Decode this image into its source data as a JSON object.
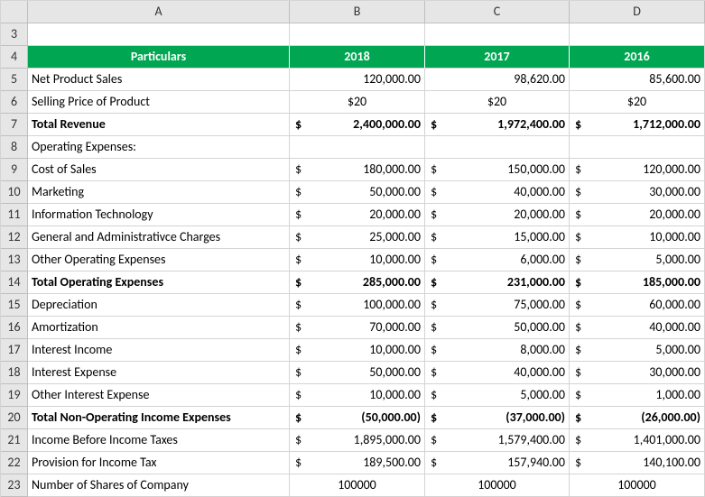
{
  "columns": [
    "A",
    "B",
    "C",
    "D"
  ],
  "row_numbers": [
    "3",
    "4",
    "5",
    "6",
    "7",
    "8",
    "9",
    "10",
    "11",
    "12",
    "13",
    "14",
    "15",
    "16",
    "17",
    "18",
    "19",
    "20",
    "21",
    "22",
    "23"
  ],
  "header": {
    "particulars": "Particulars",
    "y2018": "2018",
    "y2017": "2017",
    "y2016": "2016"
  },
  "rows": {
    "r5": {
      "label": "Net Product Sales",
      "b": "120,000.00",
      "c": "98,620.00",
      "d": "85,600.00",
      "money": false,
      "bold": false,
      "center": false
    },
    "r6": {
      "label": "Selling Price of Product",
      "b": "$20",
      "c": "$20",
      "d": "$20",
      "money": false,
      "bold": false,
      "center": true
    },
    "r7": {
      "label": "Total Revenue",
      "b": "2,400,000.00",
      "c": "1,972,400.00",
      "d": "1,712,000.00",
      "money": true,
      "bold": true,
      "center": false
    },
    "r8": {
      "label": "Operating Expenses:",
      "b": "",
      "c": "",
      "d": "",
      "money": false,
      "bold": false,
      "center": false
    },
    "r9": {
      "label": "Cost of Sales",
      "b": "180,000.00",
      "c": "150,000.00",
      "d": "120,000.00",
      "money": true,
      "bold": false,
      "center": false
    },
    "r10": {
      "label": "Marketing",
      "b": "50,000.00",
      "c": "40,000.00",
      "d": "30,000.00",
      "money": true,
      "bold": false,
      "center": false
    },
    "r11": {
      "label": "Information Technology",
      "b": "20,000.00",
      "c": "20,000.00",
      "d": "20,000.00",
      "money": true,
      "bold": false,
      "center": false
    },
    "r12": {
      "label": "General and Administrativce Charges",
      "b": "25,000.00",
      "c": "15,000.00",
      "d": "10,000.00",
      "money": true,
      "bold": false,
      "center": false
    },
    "r13": {
      "label": "Other Operating Expenses",
      "b": "10,000.00",
      "c": "6,000.00",
      "d": "5,000.00",
      "money": true,
      "bold": false,
      "center": false
    },
    "r14": {
      "label": "Total Operating Expenses",
      "b": "285,000.00",
      "c": "231,000.00",
      "d": "185,000.00",
      "money": true,
      "bold": true,
      "center": false
    },
    "r15": {
      "label": "Depreciation",
      "b": "100,000.00",
      "c": "75,000.00",
      "d": "60,000.00",
      "money": true,
      "bold": false,
      "center": false
    },
    "r16": {
      "label": "Amortization",
      "b": "70,000.00",
      "c": "50,000.00",
      "d": "40,000.00",
      "money": true,
      "bold": false,
      "center": false
    },
    "r17": {
      "label": "Interest Income",
      "b": "10,000.00",
      "c": "8,000.00",
      "d": "5,000.00",
      "money": true,
      "bold": false,
      "center": false
    },
    "r18": {
      "label": "Interest Expense",
      "b": "50,000.00",
      "c": "40,000.00",
      "d": "30,000.00",
      "money": true,
      "bold": false,
      "center": false
    },
    "r19": {
      "label": "Other Interest Expense",
      "b": "10,000.00",
      "c": "5,000.00",
      "d": "1,000.00",
      "money": true,
      "bold": false,
      "center": false
    },
    "r20": {
      "label": "Total Non-Operating Income Expenses",
      "b": "(50,000.00)",
      "c": "(37,000.00)",
      "d": "(26,000.00)",
      "money": true,
      "bold": true,
      "center": false
    },
    "r21": {
      "label": "Income Before Income Taxes",
      "b": "1,895,000.00",
      "c": "1,579,400.00",
      "d": "1,401,000.00",
      "money": true,
      "bold": false,
      "center": false
    },
    "r22": {
      "label": "Provision for Income Tax",
      "b": "189,500.00",
      "c": "157,940.00",
      "d": "140,100.00",
      "money": true,
      "bold": false,
      "center": false
    },
    "r23": {
      "label": "Number of Shares of Company",
      "b": "100000",
      "c": "100000",
      "d": "100000",
      "money": false,
      "bold": false,
      "center": true
    }
  },
  "cur_sym": "$"
}
